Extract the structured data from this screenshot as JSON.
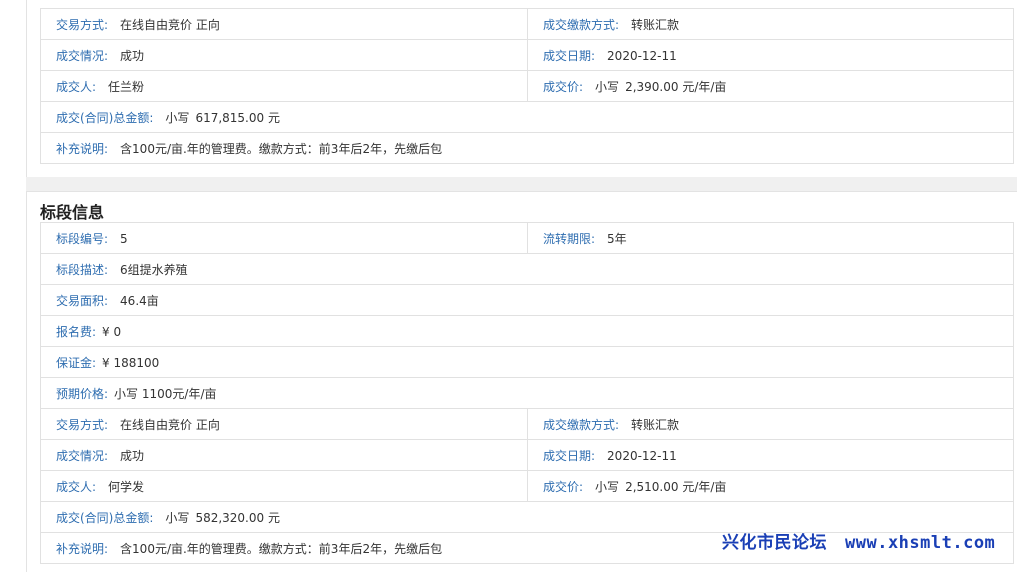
{
  "top_section": {
    "row1": {
      "trade_method_label": "交易方式:",
      "trade_method_value": "在线自由竞价 正向",
      "payment_method_label": "成交缴款方式:",
      "payment_method_value": "转账汇款"
    },
    "row2": {
      "deal_status_label": "成交情况:",
      "deal_status_value": "成功",
      "deal_date_label": "成交日期:",
      "deal_date_value": "2020-12-11"
    },
    "row3": {
      "buyer_label": "成交人:",
      "buyer_value": "任兰粉",
      "deal_price_label": "成交价:",
      "deal_price_prefix": "小写",
      "deal_price_value": "2,390.00 元/年/亩"
    },
    "row4": {
      "total_label": "成交(合同)总金额:",
      "total_prefix": "小写",
      "total_value": "617,815.00 元"
    },
    "row5": {
      "note_label": "补充说明:",
      "note_value": "含100元/亩.年的管理费。缴款方式：前3年后2年，先缴后包"
    }
  },
  "bottom_section": {
    "title": "标段信息",
    "row1": {
      "lot_no_label": "标段编号:",
      "lot_no_value": "5",
      "term_label": "流转期限:",
      "term_value": "5年"
    },
    "row2": {
      "desc_label": "标段描述:",
      "desc_value": "6组提水养殖"
    },
    "row3": {
      "area_label": "交易面积:",
      "area_value": "46.4亩"
    },
    "row4": {
      "fee_label": "报名费:",
      "fee_value": "¥ 0"
    },
    "row5": {
      "deposit_label": "保证金:",
      "deposit_value": "¥ 188100"
    },
    "row6": {
      "expected_price_label": "预期价格:",
      "expected_price_value": "小写 1100元/年/亩"
    },
    "row7": {
      "trade_method_label": "交易方式:",
      "trade_method_value": "在线自由竞价 正向",
      "payment_method_label": "成交缴款方式:",
      "payment_method_value": "转账汇款"
    },
    "row8": {
      "deal_status_label": "成交情况:",
      "deal_status_value": "成功",
      "deal_date_label": "成交日期:",
      "deal_date_value": "2020-12-11"
    },
    "row9": {
      "buyer_label": "成交人:",
      "buyer_value": "何学发",
      "deal_price_label": "成交价:",
      "deal_price_prefix": "小写",
      "deal_price_value": "2,510.00 元/年/亩"
    },
    "row10": {
      "total_label": "成交(合同)总金额:",
      "total_prefix": "小写",
      "total_value": "582,320.00 元"
    },
    "row11": {
      "note_label": "补充说明:",
      "note_value": "含100元/亩.年的管理费。缴款方式：前3年后2年，先缴后包"
    }
  },
  "watermark": {
    "name": "兴化市民论坛",
    "site": "www.xhsmlt.com"
  },
  "colors": {
    "label": "#2e6db0",
    "value": "#333333",
    "border": "#e1e1e1",
    "watermark": "#1a3fb5",
    "band": "#f0f0f0"
  }
}
